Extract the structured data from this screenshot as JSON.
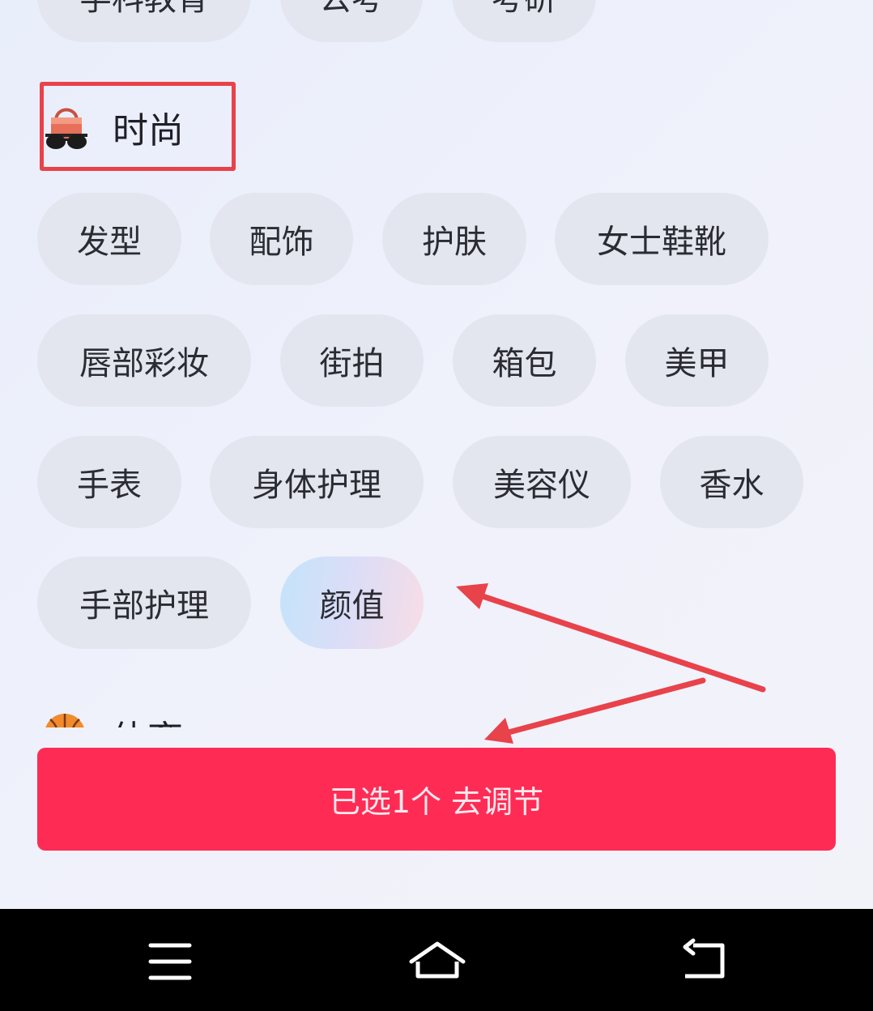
{
  "top_row_partial": [
    "学科教育",
    "公考",
    "考研"
  ],
  "section": {
    "icon": "sunglasses-handbag-icon",
    "title": "时尚"
  },
  "tags": {
    "row1": [
      "发型",
      "配饰",
      "护肤",
      "女士鞋靴"
    ],
    "row2": [
      "唇部彩妆",
      "街拍",
      "箱包",
      "美甲"
    ],
    "row3": [
      "手表",
      "身体护理",
      "美容仪",
      "香水"
    ],
    "row4": [
      "手部护理",
      "颜值"
    ]
  },
  "selected_tag": "颜值",
  "next_section": {
    "icon": "basketball-icon",
    "title": "体育"
  },
  "action_button": {
    "label": "已选1个 去调节"
  },
  "navbar": {
    "menu_icon": "menu-icon",
    "home_icon": "home-icon",
    "back_icon": "back-icon"
  },
  "colors": {
    "accent": "#fe2c55",
    "annotation": "#e8424a",
    "chip_bg": "#e3e6ef"
  }
}
